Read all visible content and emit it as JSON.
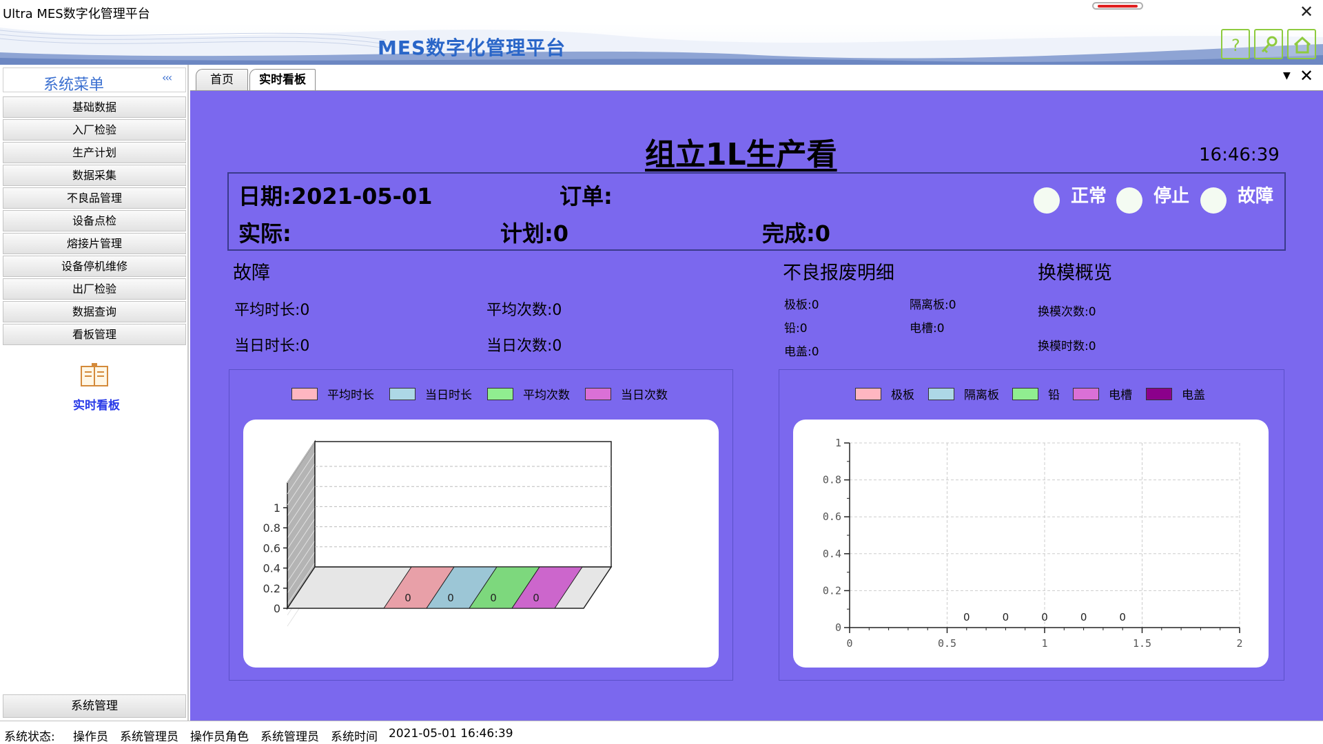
{
  "window": {
    "title": "Ultra MES数字化管理平台",
    "close_glyph": "✕"
  },
  "banner": {
    "title": "MES数字化管理平台",
    "buttons": [
      "help-icon",
      "key-icon",
      "home-icon"
    ]
  },
  "sidebar": {
    "title": "系统菜单",
    "collapse": "‹‹‹",
    "items": [
      "基础数据",
      "入厂检验",
      "生产计划",
      "数据采集",
      "不良品管理",
      "设备点检",
      "熔接片管理",
      "设备停机维修",
      "出厂检验",
      "数据查询",
      "看板管理"
    ],
    "active_item": "实时看板",
    "bottom_item": "系统管理"
  },
  "tabs": [
    {
      "label": "首页",
      "active": false
    },
    {
      "label": "实时看板",
      "active": true
    }
  ],
  "tab_controls": {
    "menu": "▼",
    "close": "✕"
  },
  "board": {
    "title": "组立1L生产看",
    "time": "16:46:39",
    "date": "日期:2021-05-01",
    "order": "订单:",
    "actual": "实际:",
    "plan": "计划:0",
    "done": "完成:0",
    "status": [
      "正常",
      "停止",
      "故障"
    ],
    "status_colors": [
      "#f4fbf2",
      "#f4fbf2",
      "#f4fbf2"
    ],
    "fault": {
      "title": "故障",
      "avg_duration": "平均时长:0",
      "avg_count": "平均次数:0",
      "day_duration": "当日时长:0",
      "day_count": "当日次数:0"
    },
    "scrap": {
      "title": "不良报废明细",
      "plate": "极板:0",
      "separator": "隔离板:0",
      "lead": "铅:0",
      "slot": "电槽:0",
      "cover": "电盖:0"
    },
    "mold": {
      "title": "换模概览",
      "count": "换模次数:0",
      "duration": "换模时数:0"
    }
  },
  "chart_data": [
    {
      "type": "bar",
      "categories": [
        "平均时长",
        "当日时长",
        "平均次数",
        "当日次数"
      ],
      "values": [
        0,
        0,
        0,
        0
      ],
      "series_colors": [
        "#e8a0a8",
        "#9cc6d6",
        "#7dd87d",
        "#cc66cc"
      ],
      "legend_colors": [
        "#ffb6c1",
        "#add8e6",
        "#90ee90",
        "#da70d6"
      ],
      "ylim": [
        0,
        1
      ],
      "yticks": [
        "0",
        "0.2",
        "0.4",
        "0.6",
        "0.8",
        "1"
      ],
      "data_labels": [
        "0",
        "0",
        "0",
        "0"
      ],
      "legend_position": "top",
      "grid": true
    },
    {
      "type": "scatter",
      "series": [
        {
          "name": "极板",
          "color": "#ffb6c1"
        },
        {
          "name": "隔离板",
          "color": "#add8e6"
        },
        {
          "name": "铅",
          "color": "#90ee90"
        },
        {
          "name": "电槽",
          "color": "#da70d6"
        },
        {
          "name": "电盖",
          "color": "#8b008b"
        }
      ],
      "xlim": [
        0,
        2
      ],
      "ylim": [
        0,
        1
      ],
      "xticks": [
        "0",
        "0.5",
        "1",
        "1.5",
        "2"
      ],
      "yticks": [
        "0",
        "0.2",
        "0.4",
        "0.6",
        "0.8",
        "1"
      ],
      "point_labels": [
        {
          "x": 0.6,
          "y": 0,
          "label": "0"
        },
        {
          "x": 0.8,
          "y": 0,
          "label": "0"
        },
        {
          "x": 1.0,
          "y": 0,
          "label": "0"
        },
        {
          "x": 1.2,
          "y": 0,
          "label": "0"
        },
        {
          "x": 1.4,
          "y": 0,
          "label": "0"
        }
      ],
      "legend_position": "top",
      "grid": true
    }
  ],
  "statusbar": {
    "status_label": "系统状态:",
    "operator_label": "操作员",
    "operator": "系统管理员",
    "role_label": "操作员角色",
    "role": "系统管理员",
    "time_label": "系统时间",
    "time": "2021-05-01 16:46:39"
  }
}
